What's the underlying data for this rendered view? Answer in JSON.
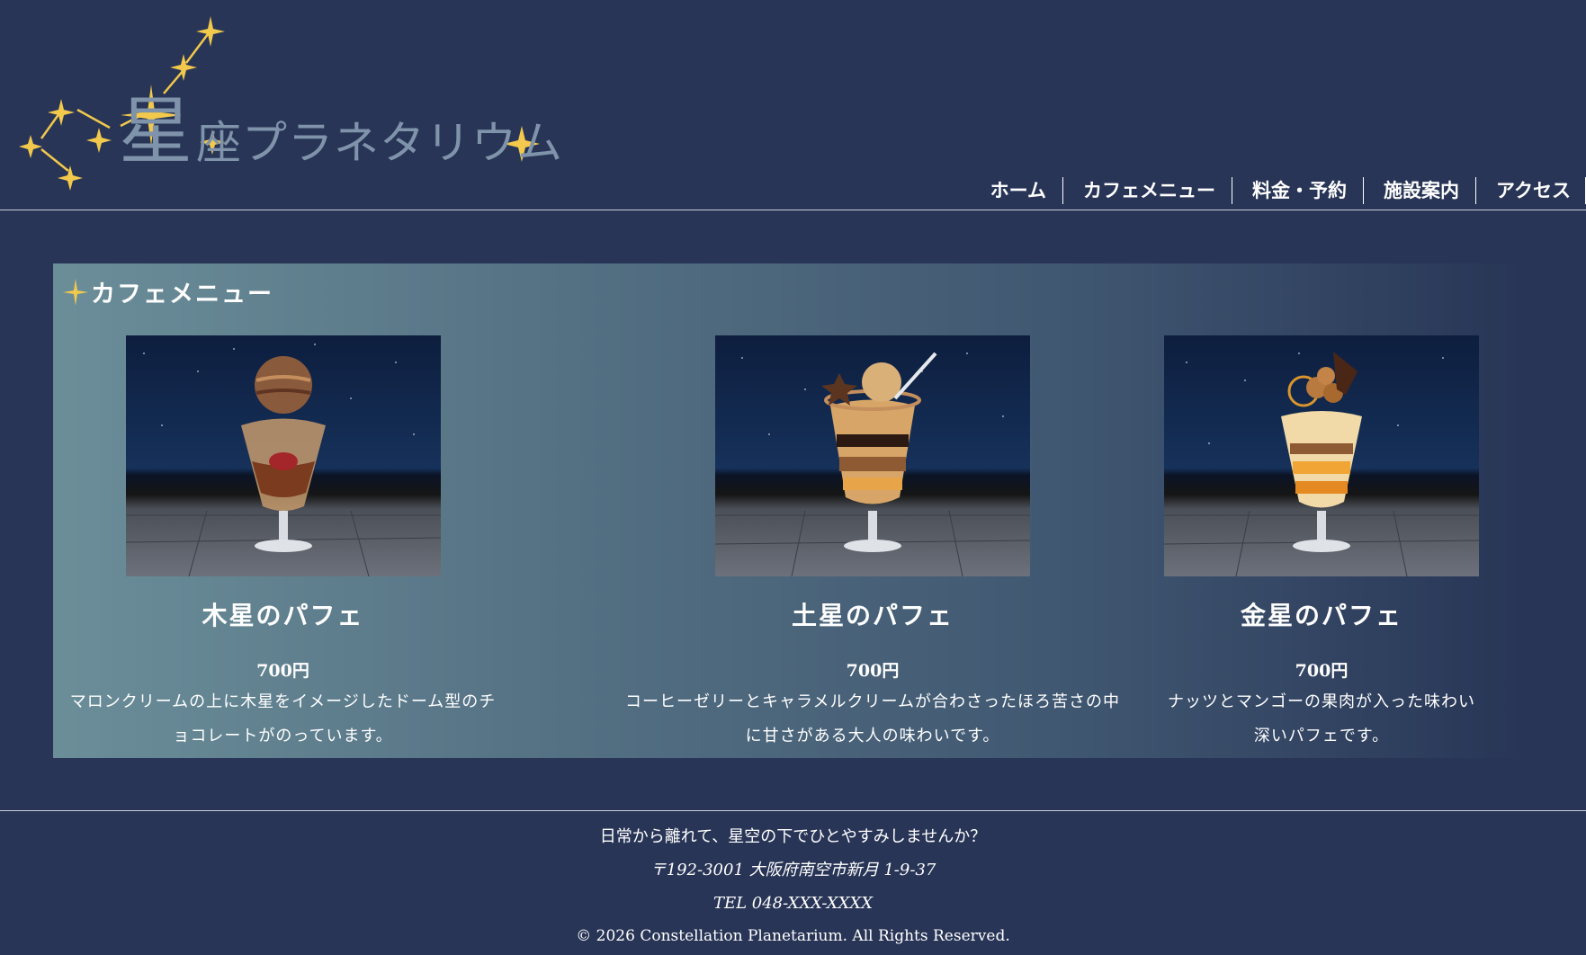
{
  "logo": {
    "big_char": "星",
    "rest": "座プラネタリウム"
  },
  "nav": {
    "items": [
      "ホーム",
      "カフェメニュー",
      "料金・予約",
      "施設案内",
      "アクセス"
    ]
  },
  "menu": {
    "heading": "カフェメニュー",
    "cards": [
      {
        "title": "木星のパフェ",
        "price": "700円",
        "desc_line1": "マロンクリームの上に木星をイメージしたドーム型のチ",
        "desc_line2": "ョコレートがのっています。"
      },
      {
        "title": "土星のパフェ",
        "price": "700円",
        "desc_line1": "コーヒーゼリーとキャラメルクリームが合わさったほろ苦さの中",
        "desc_line2": "に甘さがある大人の味わいです。"
      },
      {
        "title": "金星のパフェ",
        "price": "700円",
        "desc_line1": "ナッツとマンゴーの果肉が入った味わい",
        "desc_line2": "深いパフェです。"
      }
    ]
  },
  "footer": {
    "tagline": "日常から離れて、星空の下でひとやすみしませんか？",
    "address": "〒192-3001 大阪府南空市新月 1-9-37",
    "tel": "TEL 048-XXX-XXXX",
    "copyright": "© 2026 Constellation Planetarium. All Rights Reserved."
  },
  "colors": {
    "background": "#283556",
    "star": "#f2c94c",
    "logo_text": "#7f93aa"
  }
}
